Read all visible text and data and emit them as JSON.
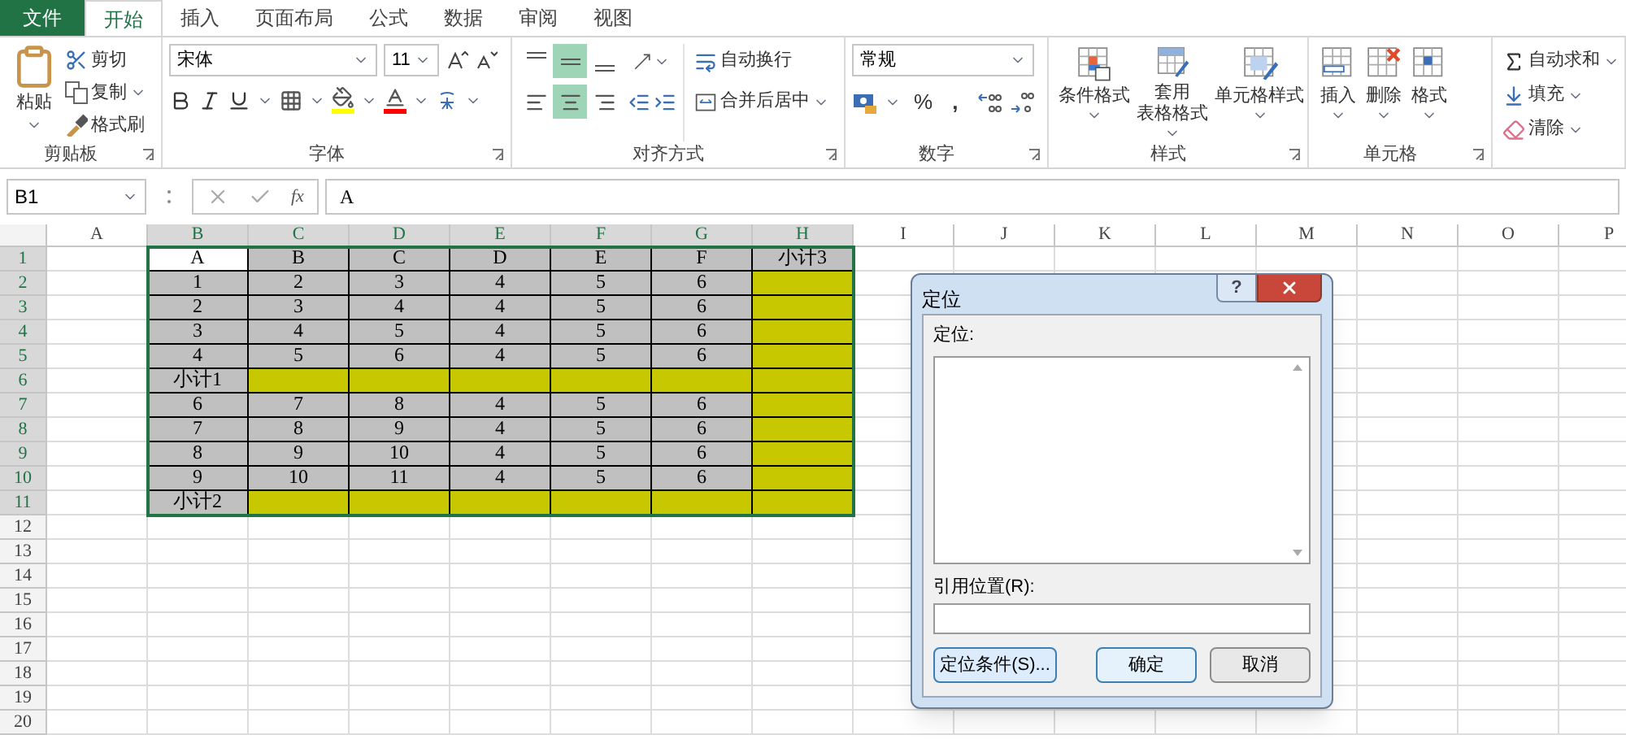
{
  "ribbon_tabs": [
    {
      "label": "文件",
      "kind": "file",
      "selected": false
    },
    {
      "label": "开始",
      "kind": "tab",
      "selected": true
    },
    {
      "label": "插入",
      "kind": "tab",
      "selected": false
    },
    {
      "label": "页面布局",
      "kind": "tab",
      "selected": false
    },
    {
      "label": "公式",
      "kind": "tab",
      "selected": false
    },
    {
      "label": "数据",
      "kind": "tab",
      "selected": false
    },
    {
      "label": "审阅",
      "kind": "tab",
      "selected": false
    },
    {
      "label": "视图",
      "kind": "tab",
      "selected": false
    }
  ],
  "clipboard": {
    "paste": "粘贴",
    "cut": "剪切",
    "copy": "复制",
    "format_painter": "格式刷",
    "title": "剪贴板"
  },
  "font": {
    "name": "宋体",
    "size": "11",
    "title": "字体"
  },
  "alignment": {
    "top": {
      "selected": false
    },
    "middle": {
      "selected": true
    },
    "bottom": {
      "selected": false
    },
    "left": {
      "selected": false
    },
    "center": {
      "selected": true
    },
    "right": {
      "selected": false
    },
    "wrap_text": "自动换行",
    "merge_center": "合并后居中",
    "title": "对齐方式"
  },
  "number": {
    "format": "常规",
    "percent": "%",
    "comma": ",",
    "title": "数字"
  },
  "styles": {
    "conditional": "条件格式",
    "table_format": [
      "套用",
      "表格格式"
    ],
    "cell_styles": "单元格样式",
    "title": "样式"
  },
  "cells": {
    "insert": "插入",
    "delete": "删除",
    "format": "格式",
    "title": "单元格"
  },
  "editing": {
    "autosum": "自动求和",
    "fill": "填充",
    "clear": "清除"
  },
  "formula_bar": {
    "name_box": "B1",
    "fx": "fx",
    "value": "A"
  },
  "columns": [
    {
      "label": "A",
      "selected": false
    },
    {
      "label": "B",
      "selected": true
    },
    {
      "label": "C",
      "selected": true
    },
    {
      "label": "D",
      "selected": true
    },
    {
      "label": "E",
      "selected": true
    },
    {
      "label": "F",
      "selected": true
    },
    {
      "label": "G",
      "selected": true
    },
    {
      "label": "H",
      "selected": true
    },
    {
      "label": "I",
      "selected": false
    },
    {
      "label": "J",
      "selected": false
    },
    {
      "label": "K",
      "selected": false
    },
    {
      "label": "L",
      "selected": false
    },
    {
      "label": "M",
      "selected": false
    },
    {
      "label": "N",
      "selected": false
    },
    {
      "label": "O",
      "selected": false
    },
    {
      "label": "P",
      "selected": false
    }
  ],
  "rows": [
    {
      "label": "1",
      "selected": true,
      "cells": [
        {
          "text": "A",
          "color": "#ffffff"
        },
        {
          "text": "B",
          "color": "#c0c0c0"
        },
        {
          "text": "C",
          "color": "#c0c0c0"
        },
        {
          "text": "D",
          "color": "#c0c0c0"
        },
        {
          "text": "E",
          "color": "#c0c0c0"
        },
        {
          "text": "F",
          "color": "#c0c0c0"
        },
        {
          "text": "小计3",
          "color": "#c0c0c0"
        }
      ]
    },
    {
      "label": "2",
      "selected": true,
      "cells": [
        {
          "text": "1",
          "color": "#c0c0c0"
        },
        {
          "text": "2",
          "color": "#c0c0c0"
        },
        {
          "text": "3",
          "color": "#c0c0c0"
        },
        {
          "text": "4",
          "color": "#c0c0c0"
        },
        {
          "text": "5",
          "color": "#c0c0c0"
        },
        {
          "text": "6",
          "color": "#c0c0c0"
        },
        {
          "color": "#c8c800"
        }
      ]
    },
    {
      "label": "3",
      "selected": true,
      "cells": [
        {
          "text": "2",
          "color": "#c0c0c0"
        },
        {
          "text": "3",
          "color": "#c0c0c0"
        },
        {
          "text": "4",
          "color": "#c0c0c0"
        },
        {
          "text": "4",
          "color": "#c0c0c0"
        },
        {
          "text": "5",
          "color": "#c0c0c0"
        },
        {
          "text": "6",
          "color": "#c0c0c0"
        },
        {
          "color": "#c8c800"
        }
      ]
    },
    {
      "label": "4",
      "selected": true,
      "cells": [
        {
          "text": "3",
          "color": "#c0c0c0"
        },
        {
          "text": "4",
          "color": "#c0c0c0"
        },
        {
          "text": "5",
          "color": "#c0c0c0"
        },
        {
          "text": "4",
          "color": "#c0c0c0"
        },
        {
          "text": "5",
          "color": "#c0c0c0"
        },
        {
          "text": "6",
          "color": "#c0c0c0"
        },
        {
          "color": "#c8c800"
        }
      ]
    },
    {
      "label": "5",
      "selected": true,
      "cells": [
        {
          "text": "4",
          "color": "#c0c0c0"
        },
        {
          "text": "5",
          "color": "#c0c0c0"
        },
        {
          "text": "6",
          "color": "#c0c0c0"
        },
        {
          "text": "4",
          "color": "#c0c0c0"
        },
        {
          "text": "5",
          "color": "#c0c0c0"
        },
        {
          "text": "6",
          "color": "#c0c0c0"
        },
        {
          "color": "#c8c800"
        }
      ]
    },
    {
      "label": "6",
      "selected": true,
      "cells": [
        {
          "text": "小计1",
          "color": "#c0c0c0"
        },
        {
          "color": "#c8c800"
        },
        {
          "color": "#c8c800"
        },
        {
          "color": "#c8c800"
        },
        {
          "color": "#c8c800"
        },
        {
          "color": "#c8c800"
        },
        {
          "color": "#c8c800"
        }
      ]
    },
    {
      "label": "7",
      "selected": true,
      "cells": [
        {
          "text": "6",
          "color": "#c0c0c0"
        },
        {
          "text": "7",
          "color": "#c0c0c0"
        },
        {
          "text": "8",
          "color": "#c0c0c0"
        },
        {
          "text": "4",
          "color": "#c0c0c0"
        },
        {
          "text": "5",
          "color": "#c0c0c0"
        },
        {
          "text": "6",
          "color": "#c0c0c0"
        },
        {
          "color": "#c8c800"
        }
      ]
    },
    {
      "label": "8",
      "selected": true,
      "cells": [
        {
          "text": "7",
          "color": "#c0c0c0"
        },
        {
          "text": "8",
          "color": "#c0c0c0"
        },
        {
          "text": "9",
          "color": "#c0c0c0"
        },
        {
          "text": "4",
          "color": "#c0c0c0"
        },
        {
          "text": "5",
          "color": "#c0c0c0"
        },
        {
          "text": "6",
          "color": "#c0c0c0"
        },
        {
          "color": "#c8c800"
        }
      ]
    },
    {
      "label": "9",
      "selected": true,
      "cells": [
        {
          "text": "8",
          "color": "#c0c0c0"
        },
        {
          "text": "9",
          "color": "#c0c0c0"
        },
        {
          "text": "10",
          "color": "#c0c0c0"
        },
        {
          "text": "4",
          "color": "#c0c0c0"
        },
        {
          "text": "5",
          "color": "#c0c0c0"
        },
        {
          "text": "6",
          "color": "#c0c0c0"
        },
        {
          "color": "#c8c800"
        }
      ]
    },
    {
      "label": "10",
      "selected": true,
      "cells": [
        {
          "text": "9",
          "color": "#c0c0c0"
        },
        {
          "text": "10",
          "color": "#c0c0c0"
        },
        {
          "text": "11",
          "color": "#c0c0c0"
        },
        {
          "text": "4",
          "color": "#c0c0c0"
        },
        {
          "text": "5",
          "color": "#c0c0c0"
        },
        {
          "text": "6",
          "color": "#c0c0c0"
        },
        {
          "color": "#c8c800"
        }
      ]
    },
    {
      "label": "11",
      "selected": true,
      "cells": [
        {
          "text": "小计2",
          "color": "#c0c0c0"
        },
        {
          "color": "#c8c800"
        },
        {
          "color": "#c8c800"
        },
        {
          "color": "#c8c800"
        },
        {
          "color": "#c8c800"
        },
        {
          "color": "#c8c800"
        },
        {
          "color": "#c8c800"
        }
      ]
    },
    {
      "label": "12",
      "selected": false
    },
    {
      "label": "13",
      "selected": false
    },
    {
      "label": "14",
      "selected": false
    },
    {
      "label": "15",
      "selected": false
    },
    {
      "label": "16",
      "selected": false
    },
    {
      "label": "17",
      "selected": false
    },
    {
      "label": "18",
      "selected": false
    },
    {
      "label": "19",
      "selected": false
    },
    {
      "label": "20",
      "selected": false
    }
  ],
  "dialog": {
    "title": "定位",
    "help": "?",
    "list_label": "定位:",
    "reference_label": "引用位置(R):",
    "buttons": [
      {
        "label": "定位条件(S)...",
        "kind": "special"
      },
      {
        "label": "确定",
        "kind": "default"
      },
      {
        "label": "取消",
        "kind": "normal"
      }
    ]
  }
}
